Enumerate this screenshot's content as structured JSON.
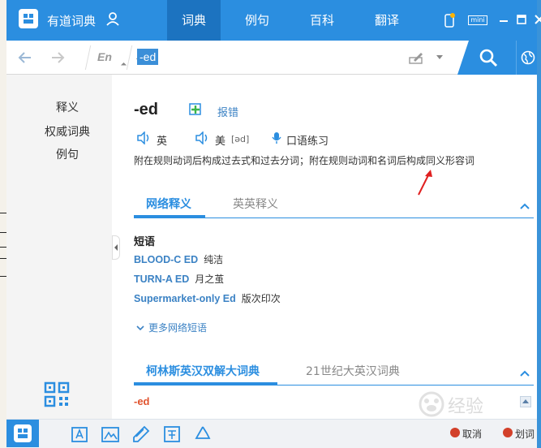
{
  "app": {
    "title": "有道词典"
  },
  "tabs": [
    {
      "label": "词典",
      "active": true
    },
    {
      "label": "例句",
      "active": false
    },
    {
      "label": "百科",
      "active": false
    },
    {
      "label": "翻译",
      "active": false
    }
  ],
  "titlebar_icons": [
    "phone-icon",
    "mini-icon",
    "minimize-icon",
    "maximize-icon",
    "close-icon"
  ],
  "titlebar_mini_label": "mini",
  "search": {
    "lang": "En",
    "value": "-ed"
  },
  "left_nav": [
    {
      "label": "释义"
    },
    {
      "label": "权威词典"
    },
    {
      "label": "例句"
    }
  ],
  "entry": {
    "headword": "-ed",
    "report_label": "报错",
    "pron_uk_label": "英",
    "pron_us_label": "美",
    "pron_us_phonetic": "[əd]",
    "speak_practice": "口语练习",
    "definition": "附在规则动词后构成过去式和过去分词；附在规则动词和名词后构成同义形容词"
  },
  "section1": {
    "tabs": [
      "网络释义",
      "英英释义"
    ],
    "active_index": 0,
    "phrase_heading": "短语",
    "phrases": [
      {
        "en": "BLOOD-C ED",
        "zh": "纯洁"
      },
      {
        "en": "TURN-A ED",
        "zh": "月之茧"
      },
      {
        "en": "Supermarket-only Ed",
        "zh": "版次印次"
      }
    ],
    "more_label": "更多网络短语"
  },
  "section2": {
    "tabs": [
      "柯林斯英汉双解大词典",
      "21世纪大英汉词典"
    ],
    "active_index": 0,
    "word": "-ed"
  },
  "bottom_bar": {
    "tools": [
      "dict-icon",
      "text-icon",
      "image-translate-icon",
      "note-icon",
      "translate-icon",
      "recycle-icon"
    ],
    "cancel_label": "取消",
    "capture_label": "划词"
  },
  "watermark": {
    "text": "经验"
  },
  "colors": {
    "brand": "#2b8ee0",
    "link": "#3b82c4",
    "accent_red": "#e0532e"
  }
}
